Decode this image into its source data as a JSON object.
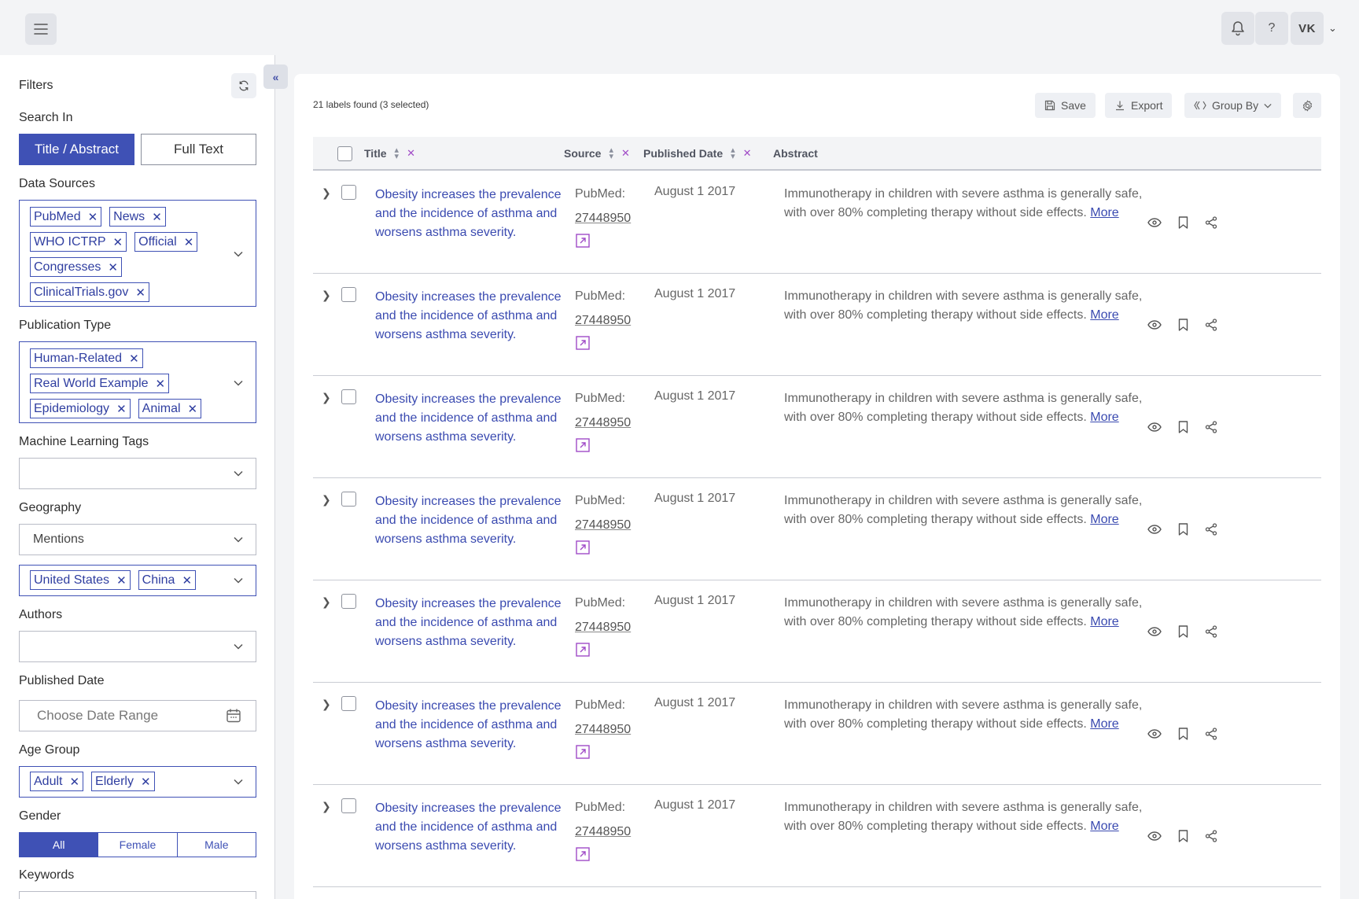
{
  "header": {
    "avatar_initials": "VK",
    "help_label": "?"
  },
  "sidebar": {
    "title": "Filters",
    "collapse_label": "«",
    "search_in": {
      "label": "Search In",
      "options": [
        "Title / Abstract",
        "Full Text"
      ],
      "active": "Title / Abstract"
    },
    "data_sources": {
      "label": "Data Sources",
      "tags": [
        "PubMed",
        "News",
        "WHO ICTRP",
        "Official",
        "Congresses",
        "ClinicalTrials.gov"
      ]
    },
    "publication_type": {
      "label": "Publication Type",
      "tags": [
        "Human-Related",
        "Real World Example",
        "Epidemiology",
        "Animal"
      ]
    },
    "ml_tags": {
      "label": "Machine Learning Tags",
      "value": ""
    },
    "geography": {
      "label": "Geography",
      "mode": "Mentions",
      "tags": [
        "United States",
        "China"
      ]
    },
    "authors": {
      "label": "Authors",
      "value": ""
    },
    "published_date": {
      "label": "Published Date",
      "placeholder": "Choose Date Range"
    },
    "age_group": {
      "label": "Age Group",
      "tags": [
        "Adult",
        "Elderly"
      ]
    },
    "gender": {
      "label": "Gender",
      "options": [
        "All",
        "Female",
        "Male"
      ],
      "active": "All"
    },
    "keywords": {
      "label": "Keywords"
    }
  },
  "toolbar": {
    "count_text": "21 labels found (3 selected)",
    "save_label": "Save",
    "export_label": "Export",
    "group_by_label": "Group By"
  },
  "table": {
    "columns": [
      "Title",
      "Source",
      "Published Date",
      "Abstract"
    ],
    "rows": [
      {
        "title": "Obesity increases the prevalence and the incidence of asthma and worsens asthma severity.",
        "source": "PubMed:",
        "pmid": "27448950",
        "date": "August 1 2017",
        "abstract": "Immunotherapy in children with severe asthma is generally safe, with over 80% completing therapy without side effects.",
        "more": "More"
      },
      {
        "title": "Obesity increases the prevalence and the incidence of asthma and worsens asthma severity.",
        "source": "PubMed:",
        "pmid": "27448950",
        "date": "August 1 2017",
        "abstract": "Immunotherapy in children with severe asthma is generally safe, with over 80% completing therapy without side effects.",
        "more": "More"
      },
      {
        "title": "Obesity increases the prevalence and the incidence of asthma and worsens asthma severity.",
        "source": "PubMed:",
        "pmid": "27448950",
        "date": "August 1 2017",
        "abstract": "Immunotherapy in children with severe asthma is generally safe, with over 80% completing therapy without side effects.",
        "more": "More"
      },
      {
        "title": "Obesity increases the prevalence and the incidence of asthma and worsens asthma severity.",
        "source": "PubMed:",
        "pmid": "27448950",
        "date": "August 1 2017",
        "abstract": "Immunotherapy in children with severe asthma is generally safe, with over 80% completing therapy without side effects.",
        "more": "More"
      },
      {
        "title": "Obesity increases the prevalence and the incidence of asthma and worsens asthma severity.",
        "source": "PubMed:",
        "pmid": "27448950",
        "date": "August 1 2017",
        "abstract": "Immunotherapy in children with severe asthma is generally safe, with over 80% completing therapy without side effects.",
        "more": "More"
      },
      {
        "title": "Obesity increases the prevalence and the incidence of asthma and worsens asthma severity.",
        "source": "PubMed:",
        "pmid": "27448950",
        "date": "August 1 2017",
        "abstract": "Immunotherapy in children with severe asthma is generally safe, with over 80% completing therapy without side effects.",
        "more": "More"
      },
      {
        "title": "Obesity increases the prevalence and the incidence of asthma and worsens asthma severity.",
        "source": "PubMed:",
        "pmid": "27448950",
        "date": "August 1 2017",
        "abstract": "Immunotherapy in children with severe asthma is generally safe, with over 80% completing therapy without side effects.",
        "more": "More"
      }
    ]
  },
  "colors": {
    "accent": "#3f51b5",
    "link": "#3a4ab0",
    "icon_purple": "#a04bc7"
  }
}
